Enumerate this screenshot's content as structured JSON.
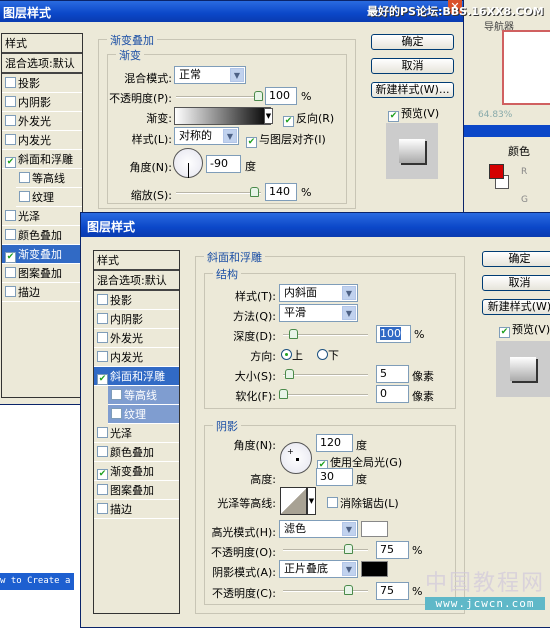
{
  "back_dialog": {
    "title": "图层样式",
    "watermark": "最好的PS论坛:BBS.16XX8.COM",
    "styles_list": [
      {
        "label": "样式",
        "checkbox": false
      },
      {
        "label": "混合选项:默认",
        "checkbox": false
      },
      {
        "label": "投影",
        "checked": false
      },
      {
        "label": "内阴影",
        "checked": false
      },
      {
        "label": "外发光",
        "checked": false
      },
      {
        "label": "内发光",
        "checked": false
      },
      {
        "label": "斜面和浮雕",
        "checked": true
      },
      {
        "label": "等高线",
        "checked": false
      },
      {
        "label": "纹理",
        "checked": false
      },
      {
        "label": "光泽",
        "checked": false
      },
      {
        "label": "颜色叠加",
        "checked": false
      },
      {
        "label": "渐变叠加",
        "checked": true,
        "selected": true
      },
      {
        "label": "图案叠加",
        "checked": false
      },
      {
        "label": "描边",
        "checked": false
      }
    ],
    "group_title": "渐变叠加",
    "subgroup_title": "渐变",
    "blend_mode_label": "混合模式:",
    "blend_mode": "正常",
    "opacity_label": "不透明度(P):",
    "opacity": "100",
    "opacity_unit": "%",
    "gradient_label": "渐变:",
    "reverse_label": "反向(R)",
    "reverse_checked": true,
    "style_label": "样式(L):",
    "style": "对称的",
    "align_label": "与图层对齐(I)",
    "align_checked": true,
    "angle_label": "角度(N):",
    "angle": "-90",
    "angle_unit": "度",
    "scale_label": "缩放(S):",
    "scale": "140",
    "scale_unit": "%",
    "buttons": {
      "ok": "确定",
      "cancel": "取消",
      "new_style": "新建样式(W)...",
      "preview": "预览(V)"
    }
  },
  "ps_panels": {
    "navigator_tab": "导航器",
    "zoom": "64.83%",
    "color_tab": "颜色",
    "r_label": "R",
    "g_label": "G",
    "foreground_color": "#d40000"
  },
  "background_page": {
    "banner": "w to Create a"
  },
  "front_dialog": {
    "title": "图层样式",
    "styles_list": [
      {
        "label": "样式"
      },
      {
        "label": "混合选项:默认"
      },
      {
        "label": "投影",
        "checked": false
      },
      {
        "label": "内阴影",
        "checked": false
      },
      {
        "label": "外发光",
        "checked": false
      },
      {
        "label": "内发光",
        "checked": false
      },
      {
        "label": "斜面和浮雕",
        "checked": true,
        "selected": true
      },
      {
        "label": "等高线",
        "checked": false
      },
      {
        "label": "纹理",
        "checked": false
      },
      {
        "label": "光泽",
        "checked": false
      },
      {
        "label": "颜色叠加",
        "checked": false
      },
      {
        "label": "渐变叠加",
        "checked": true
      },
      {
        "label": "图案叠加",
        "checked": false
      },
      {
        "label": "描边",
        "checked": false
      }
    ],
    "group_title": "斜面和浮雕",
    "structure": {
      "title": "结构",
      "style_label": "样式(T):",
      "style": "内斜面",
      "technique_label": "方法(Q):",
      "technique": "平滑",
      "depth_label": "深度(D):",
      "depth": "100",
      "depth_unit": "%",
      "direction_label": "方向:",
      "dir_up": "上",
      "dir_down": "下",
      "direction": "上",
      "size_label": "大小(S):",
      "size": "5",
      "size_unit": "像素",
      "soften_label": "软化(F):",
      "soften": "0",
      "soften_unit": "像素"
    },
    "shading": {
      "title": "阴影",
      "angle_label": "角度(N):",
      "angle": "120",
      "angle_unit": "度",
      "global_light_label": "使用全局光(G)",
      "global_light": true,
      "altitude_label": "高度:",
      "altitude": "30",
      "altitude_unit": "度",
      "gloss_label": "光泽等高线:",
      "antialias_label": "消除锯齿(L)",
      "antialias": false,
      "highlight_label": "高光模式(H):",
      "highlight_mode": "滤色",
      "highlight_color": "#ffffff",
      "h_opacity_label": "不透明度(O):",
      "h_opacity": "75",
      "h_unit": "%",
      "shadow_label": "阴影模式(A):",
      "shadow_mode": "正片叠底",
      "shadow_color": "#000000",
      "s_opacity_label": "不透明度(C):",
      "s_opacity": "75",
      "s_unit": "%"
    },
    "buttons": {
      "ok": "确定",
      "cancel": "取消",
      "new_style": "新建样式(W)",
      "preview": "预览(V)"
    }
  },
  "watermark2": {
    "cn": "中国教程网",
    "url": "www.jcwcn.com"
  }
}
